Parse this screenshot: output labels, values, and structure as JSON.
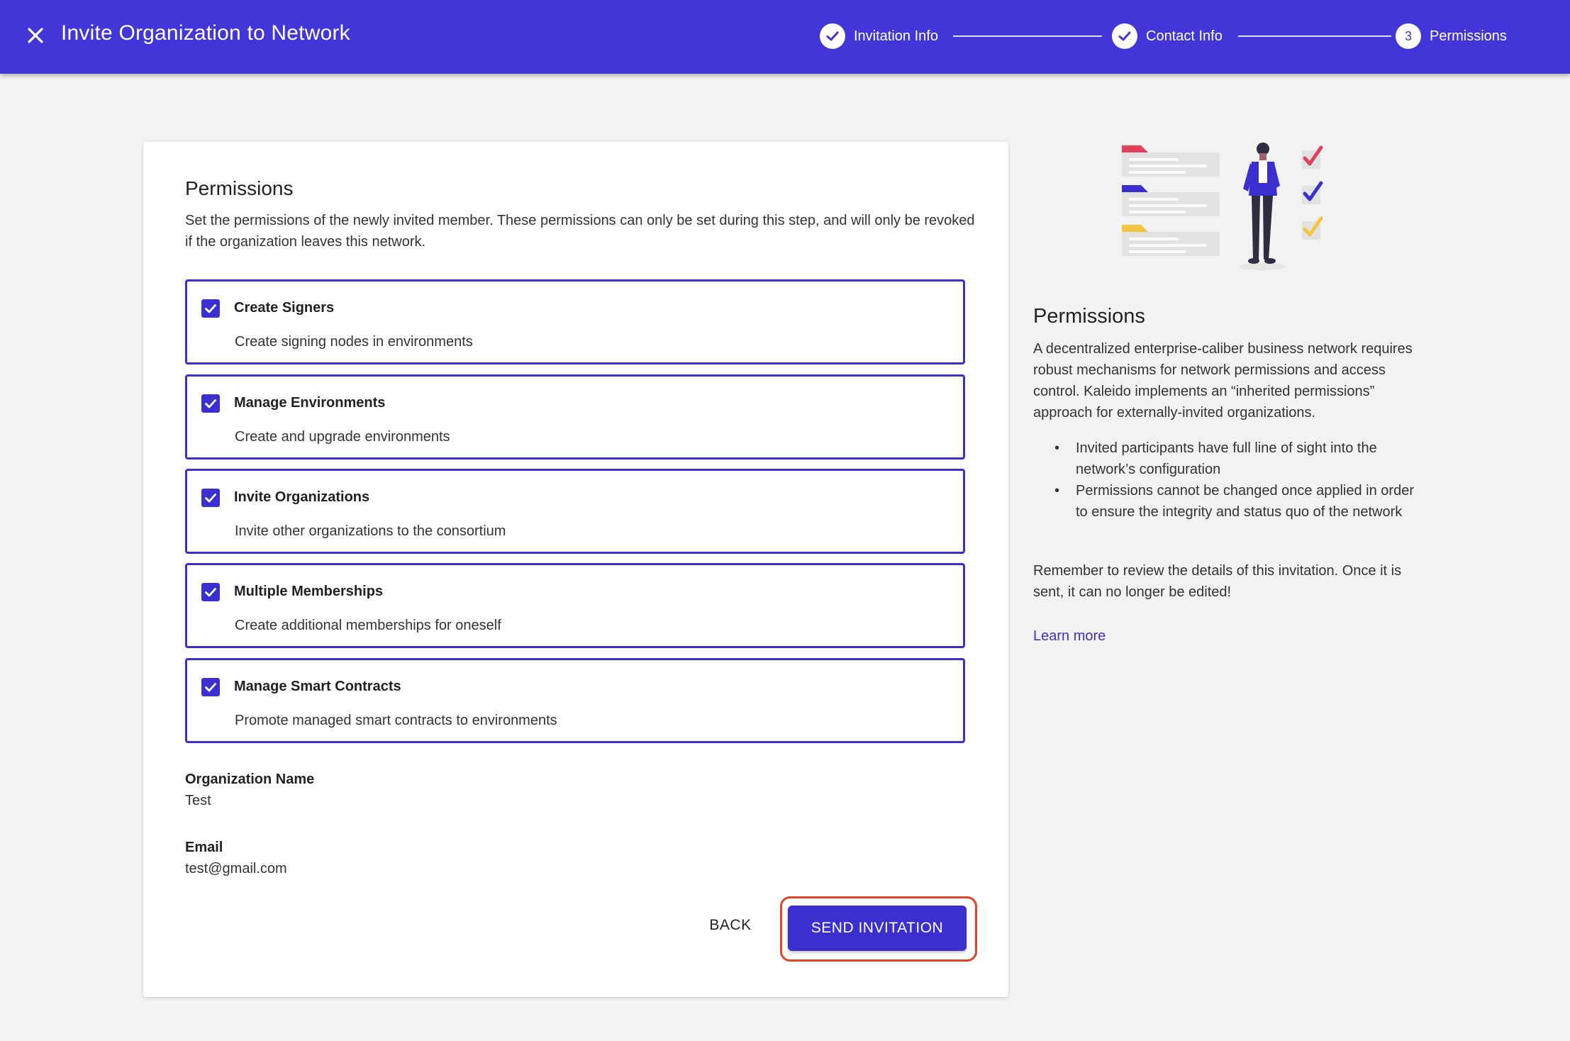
{
  "header": {
    "title": "Invite Organization to Network",
    "steps": [
      {
        "label": "Invitation Info",
        "state": "complete"
      },
      {
        "label": "Contact Info",
        "state": "complete"
      },
      {
        "label": "Permissions",
        "number": "3",
        "state": "active"
      }
    ]
  },
  "card": {
    "title": "Permissions",
    "description": "Set the permissions of the newly invited member. These permissions can only be set during this step, and will only be revoked if the organization leaves this network.",
    "permissions": [
      {
        "title": "Create Signers",
        "description": "Create signing nodes in environments",
        "checked": true
      },
      {
        "title": "Manage Environments",
        "description": "Create and upgrade environments",
        "checked": true
      },
      {
        "title": "Invite Organizations",
        "description": "Invite other organizations to the consortium",
        "checked": true
      },
      {
        "title": "Multiple Memberships",
        "description": "Create additional memberships for oneself",
        "checked": true
      },
      {
        "title": "Manage Smart Contracts",
        "description": "Promote managed smart contracts to environments",
        "checked": true
      }
    ],
    "org_name_label": "Organization Name",
    "org_name_value": "Test",
    "email_label": "Email",
    "email_value": "test@gmail.com",
    "back_label": "BACK",
    "send_label": "SEND INVITATION"
  },
  "side": {
    "title": "Permissions",
    "description": "A decentralized enterprise-caliber business network requires robust mechanisms for network permissions and access control. Kaleido implements an “inherited permissions” approach for externally-invited organizations.",
    "bullets": [
      "Invited participants have full line of sight into the network’s configuration",
      "Permissions cannot be changed once applied in order to ensure the integrity and status quo of the network"
    ],
    "remember": "Remember to review the details of this invitation. Once it is sent, it can no longer be edited!",
    "learn_more": "Learn more"
  },
  "colors": {
    "primary": "#4236d9",
    "checkbox": "#3b2fd0",
    "highlight": "#e0442b",
    "check_red": "#e0405a",
    "check_blue": "#3b2fd0",
    "check_yellow": "#f3c63f"
  }
}
